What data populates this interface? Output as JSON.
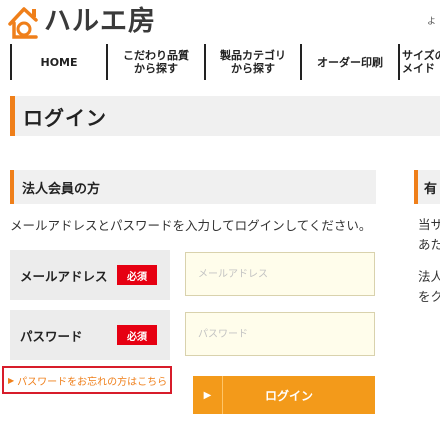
{
  "header": {
    "logo_text": "ハルエ房",
    "top_right_text": "よ"
  },
  "nav": {
    "items": [
      {
        "label": "HOME"
      },
      {
        "label": "こだわり品質\nから探す"
      },
      {
        "label": "製品カテゴリ\nから探す"
      },
      {
        "label": "オーダー印刷"
      },
      {
        "label": "サイズの\nメイド"
      }
    ]
  },
  "page": {
    "title": "ログイン"
  },
  "corporate": {
    "heading": "法人会員の方",
    "instruction": "メールアドレスとパスワードを入力してログインしてください。",
    "email_label": "メールアドレス",
    "email_required": "必須",
    "email_placeholder": "メールアドレス",
    "password_label": "パスワード",
    "password_required": "必須",
    "password_placeholder": "パスワード",
    "forgot_link": "パスワードをお忘れの方はこちら",
    "login_button": "ログイン"
  },
  "side": {
    "heading": "有",
    "lines": [
      "当サ",
      "あた",
      "法人",
      "をク"
    ]
  },
  "colors": {
    "accent": "#ef7f1a",
    "button": "#f39a1a",
    "required": "#e60012",
    "highlight_border": "#d71c2a"
  }
}
